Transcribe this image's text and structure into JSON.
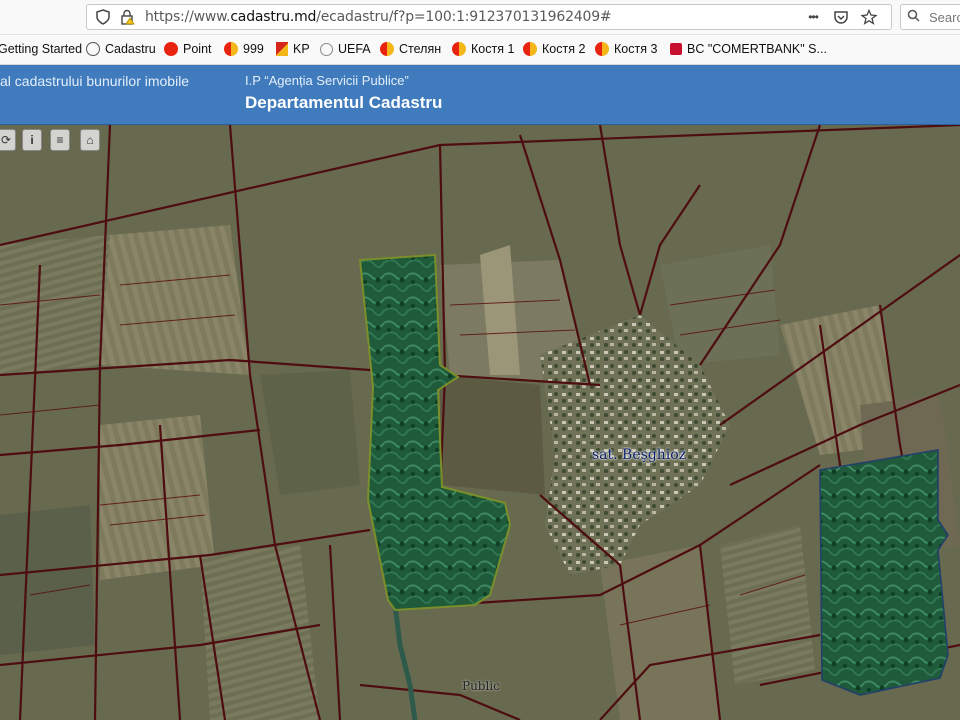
{
  "browser": {
    "url_prefix": "https://www.",
    "url_domain": "cadastru.md",
    "url_path": "/ecadastru/f?p=100:1:912370131962409#",
    "search_placeholder": "Search",
    "menu_dots": "•••"
  },
  "bookmarks": [
    {
      "label": "Getting Started",
      "icon": "firefox-icon",
      "color": "#e66000"
    },
    {
      "label": "Cadastru",
      "icon": "globe-icon",
      "color": "#555555"
    },
    {
      "label": "Point",
      "icon": "red-circle-icon",
      "color": "#e8230f"
    },
    {
      "label": "999",
      "icon": "yandex-zen-icon",
      "color": "#f3b71a"
    },
    {
      "label": "KP",
      "icon": "kp-icon",
      "color": "#d6261c"
    },
    {
      "label": "UEFA",
      "icon": "uefa-icon",
      "color": "#8a8a8a"
    },
    {
      "label": "Стелян",
      "icon": "yandex-zen-icon",
      "color": "#f3b71a"
    },
    {
      "label": "Костя 1",
      "icon": "yandex-zen-icon",
      "color": "#f3b71a"
    },
    {
      "label": "Костя 2",
      "icon": "yandex-zen-icon",
      "color": "#f3b71a"
    },
    {
      "label": "Костя 3",
      "icon": "yandex-zen-icon",
      "color": "#f3b71a"
    },
    {
      "label": "BC \"COMERTBANK\" S...",
      "icon": "comertbank-icon",
      "color": "#c8102e"
    }
  ],
  "header": {
    "left_text": "al cadastrului bunurilor imobile",
    "org": "I.P “Agenția Servicii Publice”",
    "title": "Departamentul Cadastru",
    "color": "#3f7bbd"
  },
  "map": {
    "village_label": "sat. Beşghioz",
    "public_label": "Public",
    "tools": [
      "pan-icon",
      "info-icon",
      "layers-icon",
      "home-icon"
    ],
    "highlight_color": "#1f5e3c",
    "parcel_line_color": "#5a0f12"
  }
}
